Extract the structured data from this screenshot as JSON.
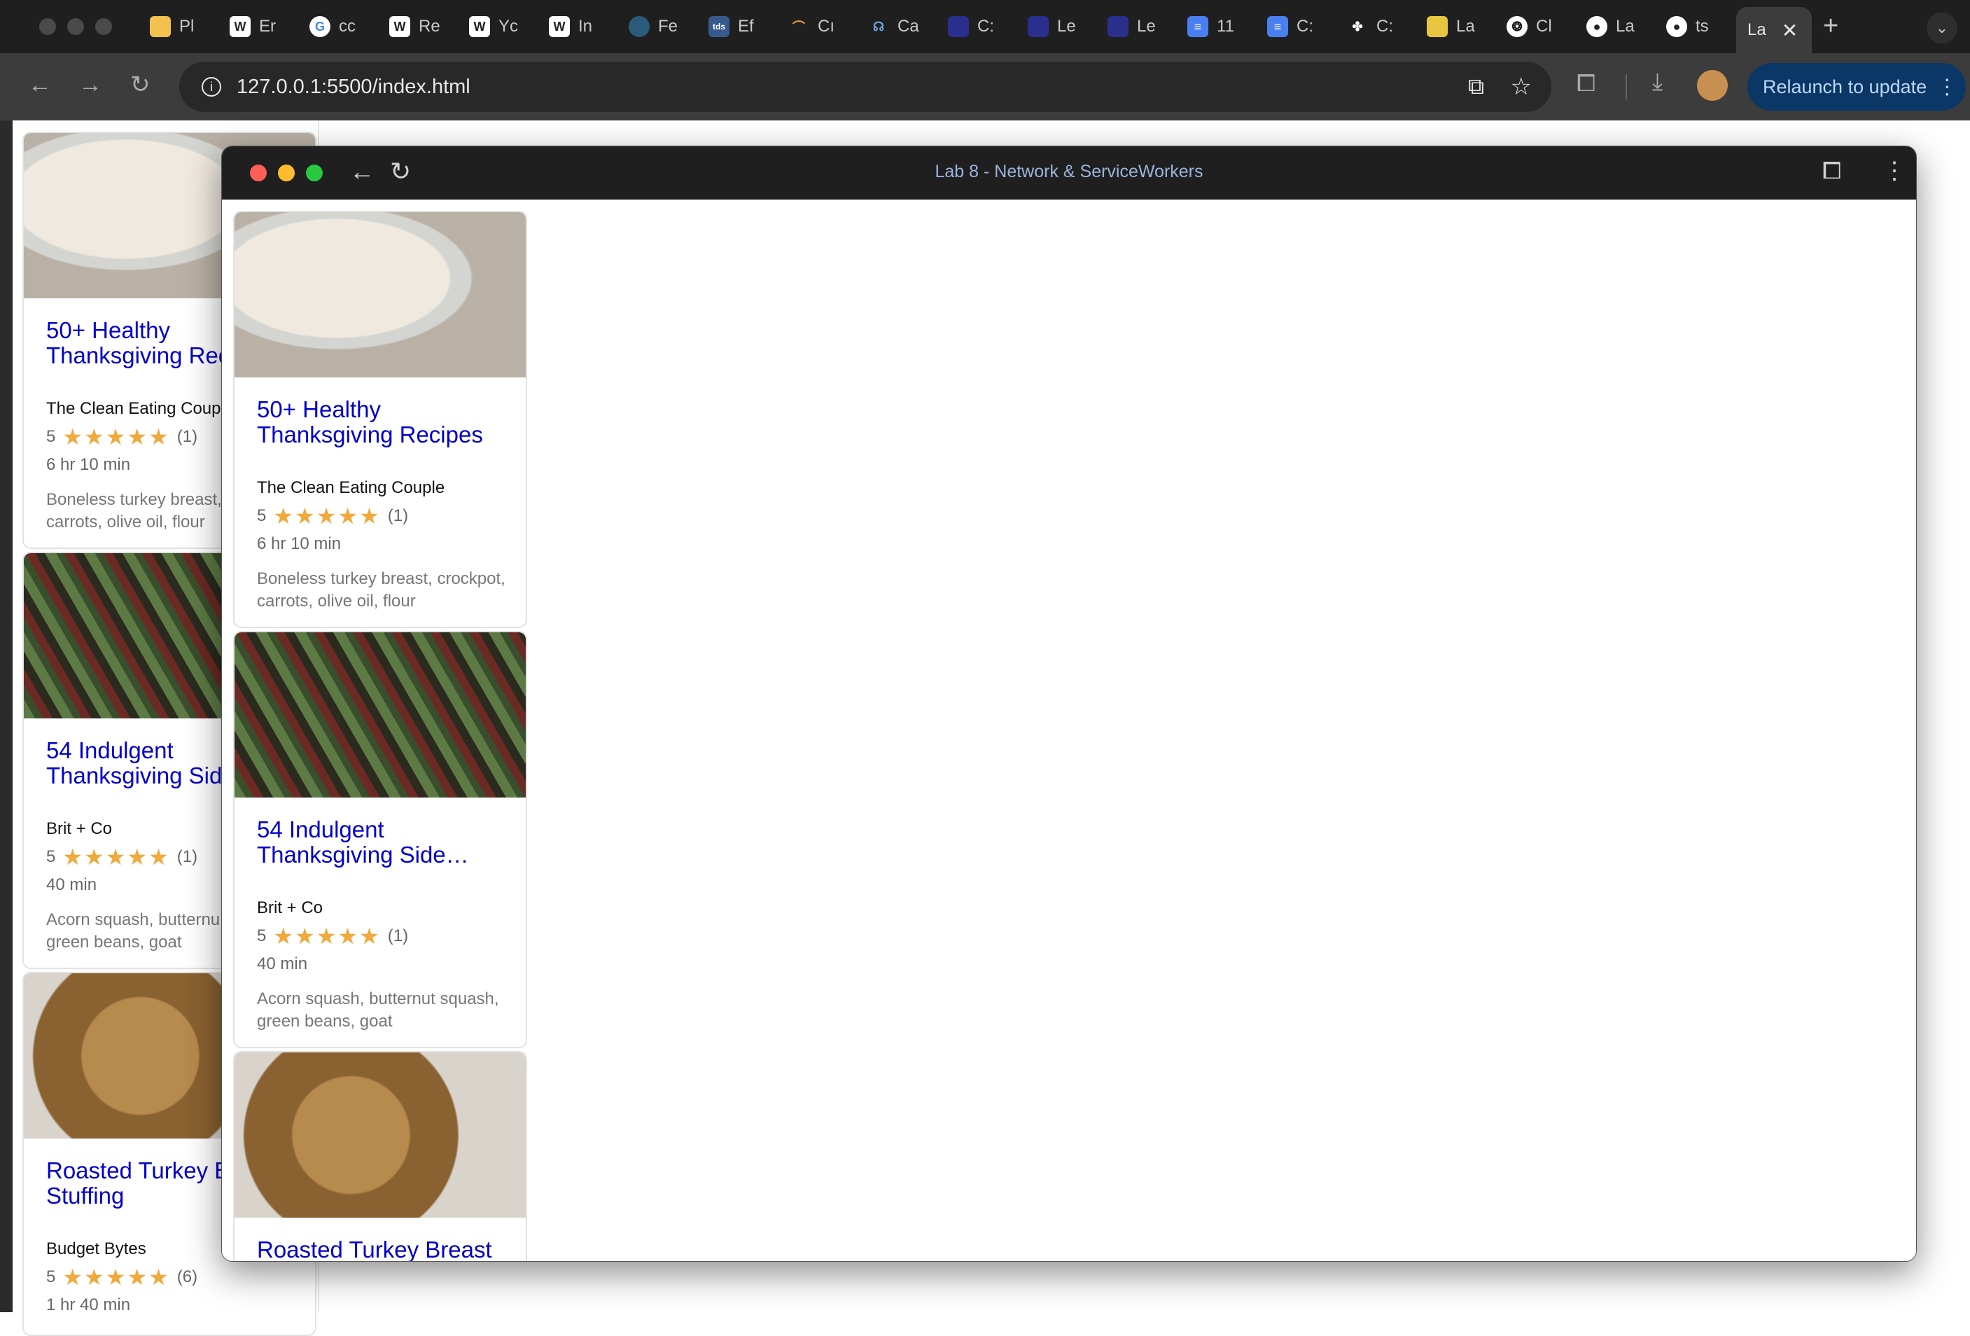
{
  "browser": {
    "tabs": [
      "Pl",
      "Er",
      "cc",
      "Re",
      "Yc",
      "In",
      "Fe",
      "Ef",
      "Cı",
      "Ca",
      "C:",
      "Le",
      "Le",
      "11",
      "C:",
      "C:",
      "La",
      "Cl",
      "La",
      "ts"
    ],
    "active_tab": "La",
    "new_tab": "+",
    "url": "127.0.0.1:5500/index.html",
    "relaunch_label": "Relaunch to update"
  },
  "popup": {
    "title": "Lab 8 - Network & ServiceWorkers"
  },
  "colors": {
    "link": "#0000cc",
    "star": "#f0a93b",
    "relaunch_bg": "#0b3766"
  },
  "recipes": [
    {
      "title": "50+ Healthy Thanksgiving Recipes",
      "title_clipped": "50+ Healthy Thanksgiving Rec",
      "org": "The Clean Eating Couple",
      "org_clipped": "The Clean Eating Coup",
      "rating": "5",
      "count": "(1)",
      "time": "6 hr 10 min",
      "ingredients": "Boneless turkey breast, crockpot, carrots, olive oil, flour",
      "ingredients_clipped": "Boneless turkey breast, carrots, olive oil, flour"
    },
    {
      "title": "54 Indulgent Thanksgiving Side…",
      "title_clipped": "54 Indulgent Thanksgiving Side",
      "org": "Brit + Co",
      "org_clipped": "Brit + Co",
      "rating": "5",
      "count": "(1)",
      "time": "40 min",
      "ingredients": "Acorn squash, butternut squash, green beans, goat",
      "ingredients_clipped": "Acorn squash, butternu green beans, goat"
    },
    {
      "title": "Roasted Turkey Breast",
      "title_clipped": "Roasted Turkey B with Stuffing",
      "org": "Budget Bytes",
      "org_clipped": "Budget Bytes",
      "rating": "5",
      "count": "(6)",
      "time": "1 hr 40 min",
      "ingredients": "",
      "ingredients_clipped": ""
    }
  ]
}
